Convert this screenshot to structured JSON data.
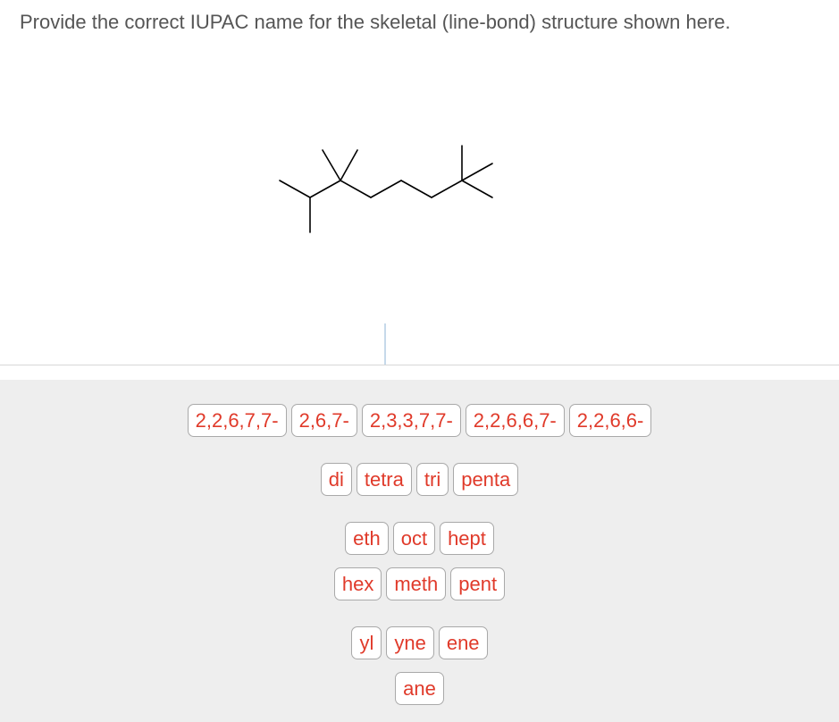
{
  "question": {
    "text": "Provide the correct IUPAC name for the skeletal (line-bond) structure shown here."
  },
  "structure": {
    "description": "skeletal structure: 2,3,3,7,7-pentamethyloctane",
    "line_color": "#000000"
  },
  "answer": {
    "value": ""
  },
  "palette": {
    "text_color": "#e03a2a",
    "rows": [
      {
        "tiles": [
          "2,2,6,7,7-",
          "2,6,7-",
          "2,3,3,7,7-",
          "2,2,6,6,7-",
          "2,2,6,6-"
        ]
      },
      {
        "tiles": [
          "di",
          "tetra",
          "tri",
          "penta"
        ]
      },
      {
        "tiles": [
          "eth",
          "oct",
          "hept"
        ]
      },
      {
        "tiles": [
          "hex",
          "meth",
          "pent"
        ]
      },
      {
        "tiles": [
          "yl",
          "yne",
          "ene"
        ]
      },
      {
        "tiles": [
          "ane"
        ]
      }
    ]
  }
}
